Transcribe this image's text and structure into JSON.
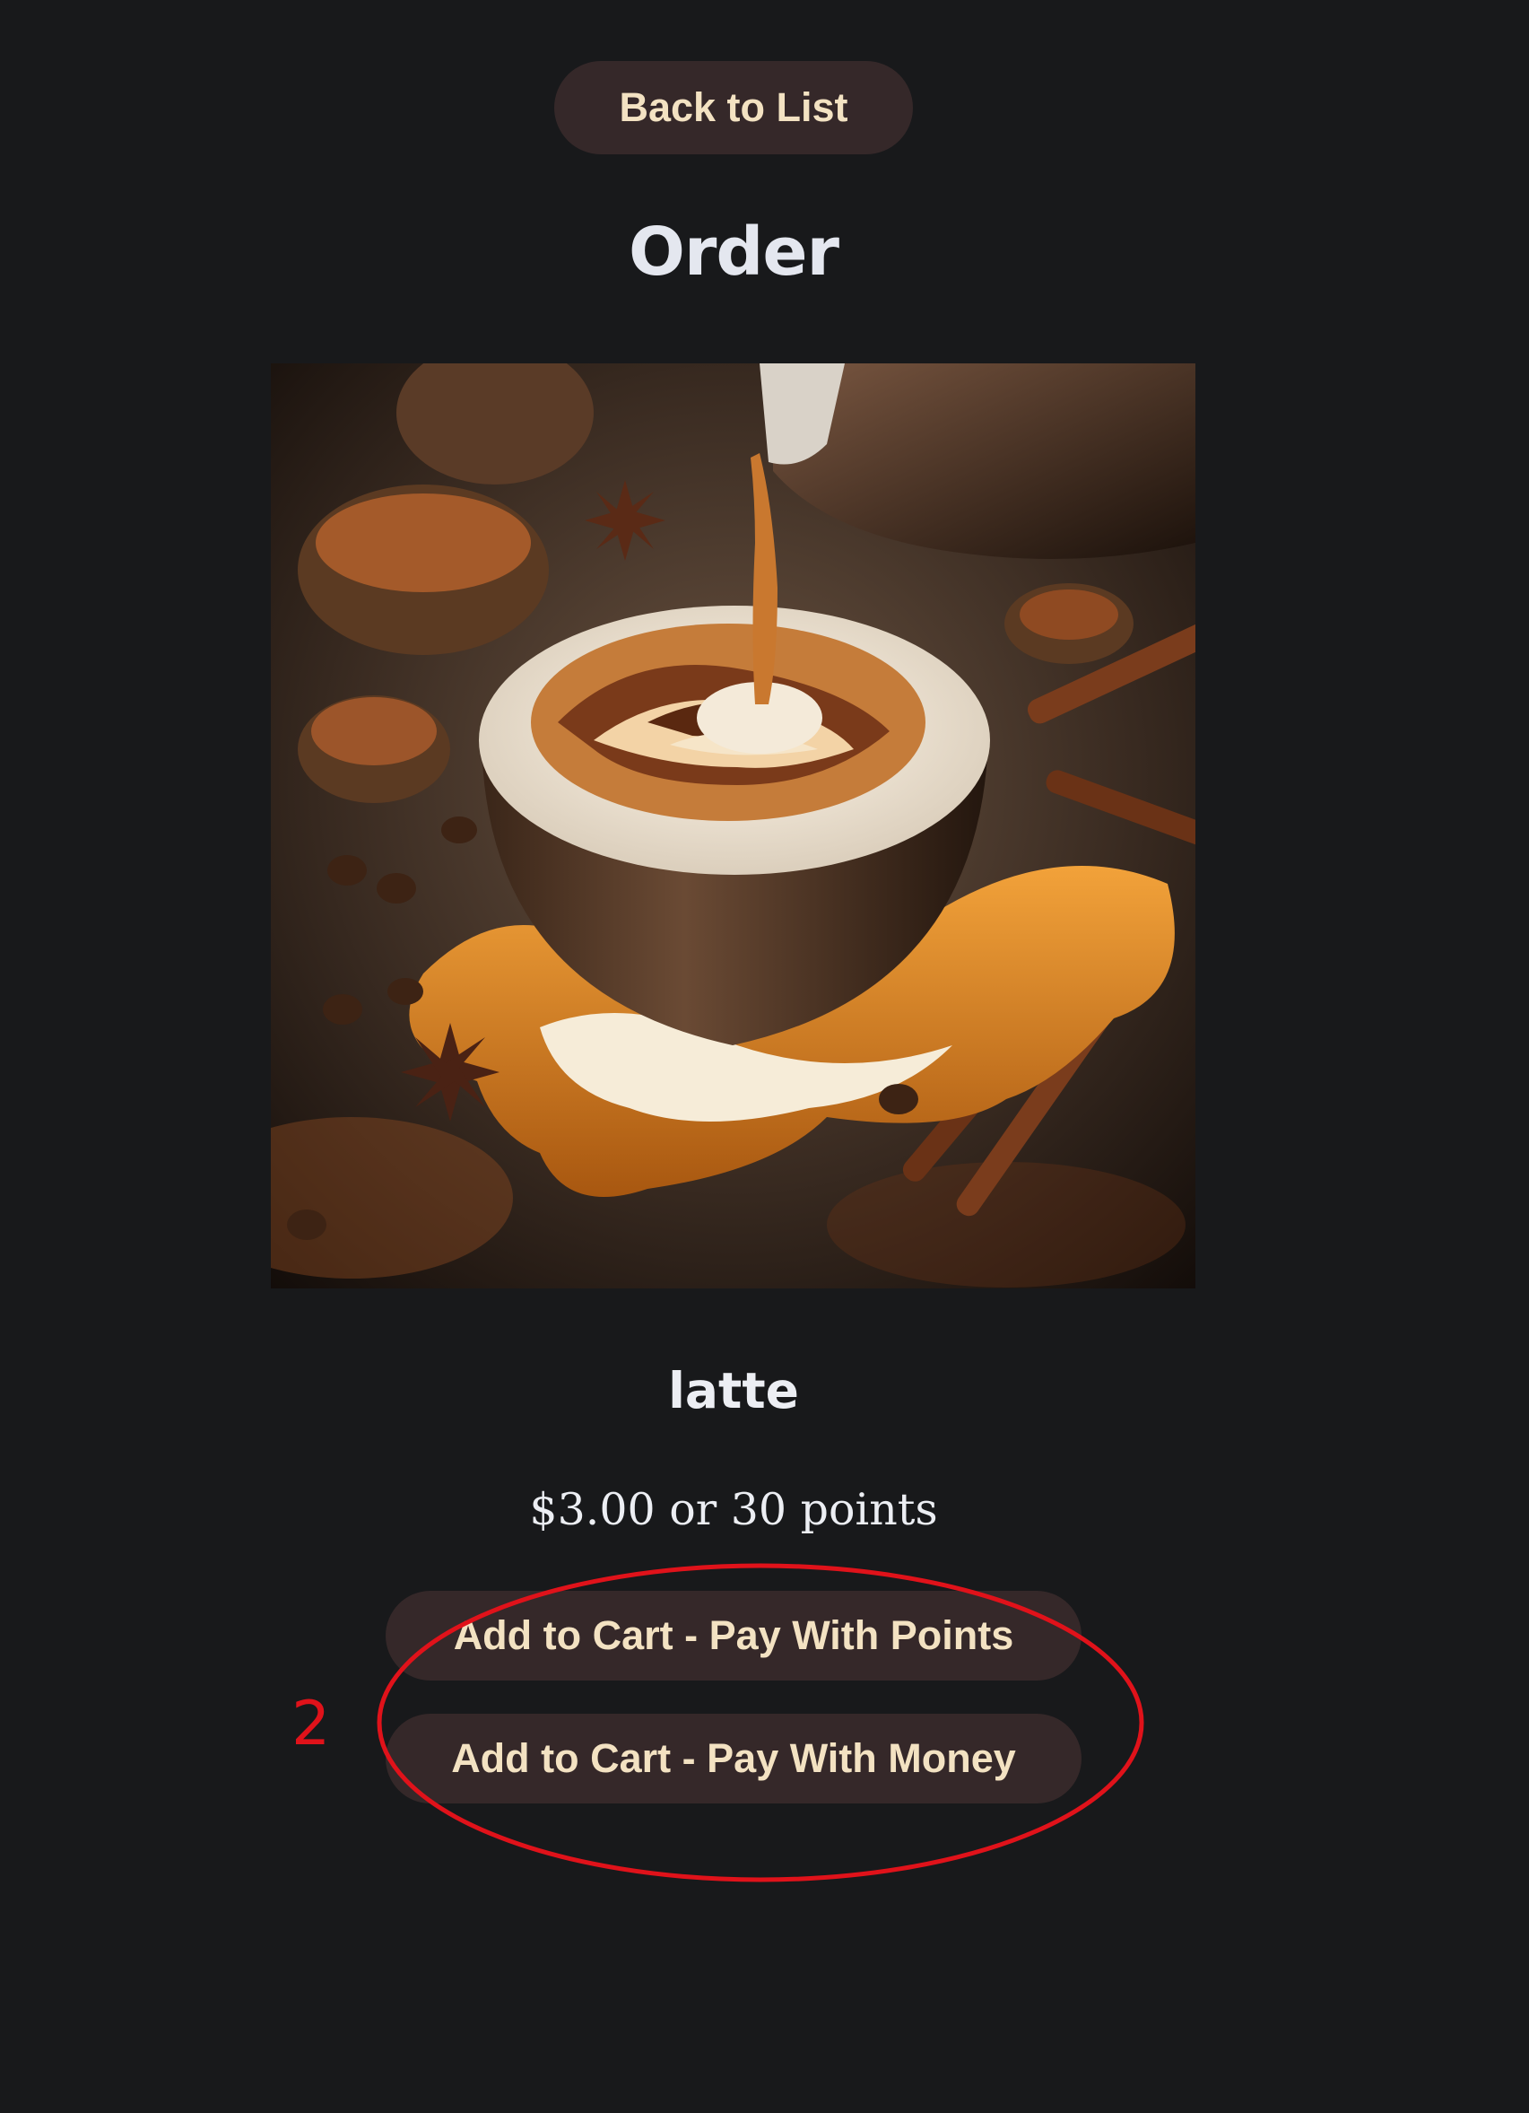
{
  "nav": {
    "back_label": "Back to List"
  },
  "page": {
    "title": "Order"
  },
  "product": {
    "name": "latte",
    "price_text": "$3.00 or 30 points"
  },
  "actions": {
    "pay_points_label": "Add to Cart - Pay With Points",
    "pay_money_label": "Add to Cart - Pay With Money"
  },
  "annotation": {
    "number": "2",
    "color": "#e0121a"
  },
  "theme": {
    "background": "#18191b",
    "button_bg": "#352829",
    "button_text": "#f3e2c2"
  }
}
